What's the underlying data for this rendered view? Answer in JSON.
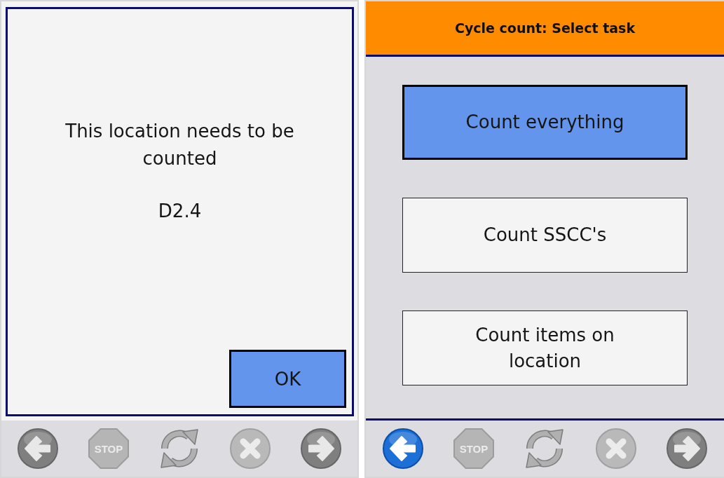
{
  "screens": [
    {
      "kind": "message",
      "message": "This location needs to be counted",
      "location": "D2.4",
      "button": {
        "label": "OK",
        "selected": true
      },
      "toolbar": [
        {
          "kind": "back",
          "disabled": true
        },
        {
          "kind": "stop",
          "label": "STOP",
          "disabled": true
        },
        {
          "kind": "refresh",
          "disabled": true
        },
        {
          "kind": "cancel",
          "disabled": true
        },
        {
          "kind": "forward",
          "disabled": true
        }
      ]
    },
    {
      "kind": "menu",
      "title": "Cycle count: Select task",
      "options": [
        {
          "label": "Count everything",
          "selected": true
        },
        {
          "label": "Count SSCC's",
          "selected": false
        },
        {
          "label": "Count items on location",
          "selected": false
        }
      ],
      "toolbar": [
        {
          "kind": "back",
          "disabled": false
        },
        {
          "kind": "stop",
          "label": "STOP",
          "disabled": true
        },
        {
          "kind": "refresh",
          "disabled": true
        },
        {
          "kind": "cancel",
          "disabled": true
        },
        {
          "kind": "forward",
          "disabled": true
        }
      ]
    }
  ]
}
